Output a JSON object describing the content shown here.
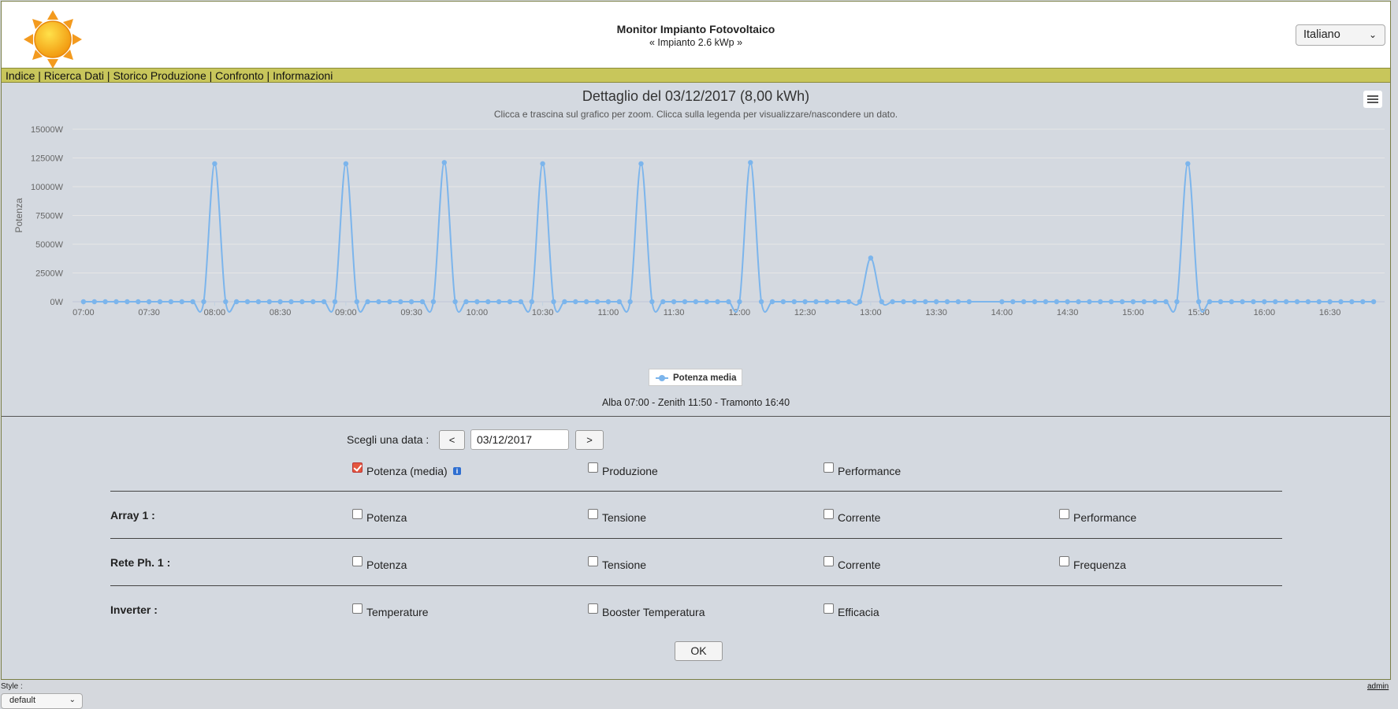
{
  "header": {
    "title": "Monitor Impianto Fotovoltaico",
    "subtitle": "« Impianto 2.6 kWp »",
    "language": "Italiano"
  },
  "nav": {
    "items": [
      "Indice",
      "Ricerca Dati",
      "Storico Produzione",
      "Confronto",
      "Informazioni"
    ],
    "separator": " | "
  },
  "chart_data": {
    "type": "line",
    "title": "Dettaglio del 03/12/2017 (8,00 kWh)",
    "subtitle": "Clicca e trascina sul grafico per zoom. Clicca sulla legenda per visualizzare/nascondere un dato.",
    "ylabel": "Potenza",
    "ylim": [
      0,
      15000
    ],
    "y_ticks": [
      "0W",
      "2500W",
      "5000W",
      "7500W",
      "10000W",
      "12500W",
      "15000W"
    ],
    "x_range": [
      "07:00",
      "16:50"
    ],
    "x_ticks": [
      "07:00",
      "07:30",
      "08:00",
      "08:30",
      "09:00",
      "09:30",
      "10:00",
      "10:30",
      "11:00",
      "11:30",
      "12:00",
      "12:30",
      "13:00",
      "13:30",
      "14:00",
      "14:30",
      "15:00",
      "15:30",
      "16:00",
      "16:30"
    ],
    "grid": true,
    "legend_position": "bottom-center",
    "series": [
      {
        "name": "Potenza media",
        "color": "#7cb5ec",
        "x": [
          "07:00",
          "07:05",
          "07:10",
          "07:15",
          "07:20",
          "07:25",
          "07:30",
          "07:35",
          "07:40",
          "07:45",
          "07:50",
          "07:55",
          "08:00",
          "08:05",
          "08:10",
          "08:15",
          "08:20",
          "08:25",
          "08:30",
          "08:35",
          "08:40",
          "08:45",
          "08:50",
          "08:55",
          "09:00",
          "09:05",
          "09:10",
          "09:15",
          "09:20",
          "09:25",
          "09:30",
          "09:35",
          "09:40",
          "09:45",
          "09:50",
          "09:55",
          "10:00",
          "10:05",
          "10:10",
          "10:15",
          "10:20",
          "10:25",
          "10:30",
          "10:35",
          "10:40",
          "10:45",
          "10:50",
          "10:55",
          "11:00",
          "11:05",
          "11:10",
          "11:15",
          "11:20",
          "11:25",
          "11:30",
          "11:35",
          "11:40",
          "11:45",
          "11:50",
          "11:55",
          "12:00",
          "12:05",
          "12:10",
          "12:15",
          "12:20",
          "12:25",
          "12:30",
          "12:35",
          "12:40",
          "12:45",
          "12:50",
          "12:55",
          "13:00",
          "13:05",
          "13:10",
          "13:15",
          "13:20",
          "13:25",
          "13:30",
          "13:35",
          "13:40",
          "13:45",
          "14:00",
          "14:05",
          "14:10",
          "14:15",
          "14:20",
          "14:25",
          "14:30",
          "14:35",
          "14:40",
          "14:45",
          "14:50",
          "14:55",
          "15:00",
          "15:05",
          "15:10",
          "15:15",
          "15:20",
          "15:25",
          "15:30",
          "15:35",
          "15:40",
          "15:45",
          "15:50",
          "15:55",
          "16:00",
          "16:05",
          "16:10",
          "16:15",
          "16:20",
          "16:25",
          "16:30",
          "16:35",
          "16:40",
          "16:45",
          "16:50"
        ],
        "values": [
          0,
          0,
          0,
          0,
          0,
          0,
          0,
          0,
          0,
          0,
          0,
          0,
          12000,
          0,
          0,
          0,
          0,
          0,
          0,
          0,
          0,
          0,
          0,
          0,
          12000,
          0,
          0,
          0,
          0,
          0,
          0,
          0,
          0,
          12100,
          0,
          0,
          0,
          0,
          0,
          0,
          0,
          0,
          12000,
          0,
          0,
          0,
          0,
          0,
          0,
          0,
          0,
          12000,
          0,
          0,
          0,
          0,
          0,
          0,
          0,
          0,
          0,
          12100,
          0,
          0,
          0,
          0,
          0,
          0,
          0,
          0,
          0,
          0,
          3800,
          0,
          0,
          0,
          0,
          0,
          0,
          0,
          0,
          0,
          0,
          0,
          0,
          0,
          0,
          0,
          0,
          0,
          0,
          0,
          0,
          0,
          0,
          0,
          0,
          0,
          0,
          12000,
          0,
          0,
          0,
          0,
          0,
          0,
          0,
          0,
          0,
          0,
          0,
          0,
          0,
          0,
          0,
          0,
          0
        ]
      }
    ]
  },
  "sun_times": "Alba 07:00 - Zenith 11:50 - Tramonto 16:40",
  "form": {
    "date_label": "Scegli una data :",
    "prev_label": "<",
    "next_label": ">",
    "date_value": "03/12/2017",
    "main_options": [
      {
        "label": "Potenza (media)",
        "checked": true
      },
      {
        "label": "Produzione",
        "checked": false
      },
      {
        "label": "Performance",
        "checked": false
      }
    ],
    "info_icon": "i",
    "rows": [
      {
        "label": "Array 1 :",
        "options": [
          "Potenza",
          "Tensione",
          "Corrente",
          "Performance"
        ]
      },
      {
        "label": "Rete Ph. 1 :",
        "options": [
          "Potenza",
          "Tensione",
          "Corrente",
          "Frequenza"
        ]
      },
      {
        "label": "Inverter :",
        "options": [
          "Temperature",
          "Booster Temperatura",
          "Efficacia"
        ]
      }
    ],
    "ok_label": "OK"
  },
  "footer": {
    "style_label": "Style :",
    "style_value": "default",
    "admin_label": "admin"
  },
  "icons": {
    "logo": "sun-icon",
    "chart_menu": "hamburger-menu-icon"
  }
}
